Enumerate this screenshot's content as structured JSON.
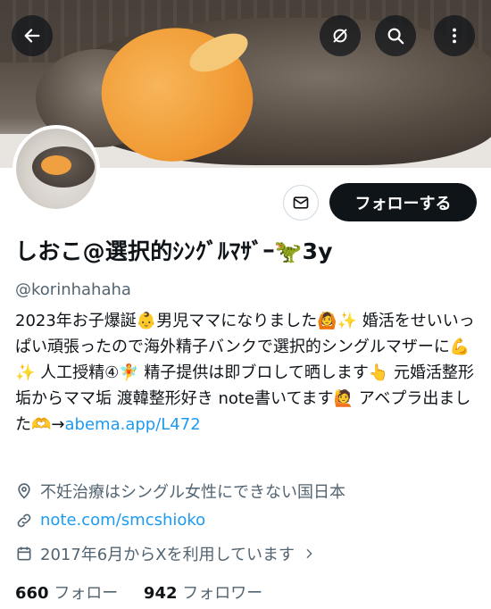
{
  "header": {
    "back_icon": "arrow-left-icon",
    "mute_icon": "mute-icon",
    "search_icon": "search-icon",
    "more_icon": "more-vertical-icon"
  },
  "actions": {
    "message_icon": "mail-icon",
    "follow_label": "フォローする"
  },
  "profile": {
    "display_name": "しおこ@選択的ｼﾝｸﾞﾙﾏｻﾞｰ🦖3y",
    "handle": "@korinhahaha",
    "bio": "2023年お子爆誕👶男児ママになりました🙆✨ 婚活をせいいっぱい頑張ったので海外精子バンクで選択的シングルマザーに💪✨ 人工授精④🧚 精子提供は即ブロして晒します👆 元婚活整形垢からママ垢 渡韓整形好き note書いてます🙋 アベプラ出ました🫶→",
    "bio_link": "abema.app/L472",
    "location": "不妊治療はシングル女性にできない国日本",
    "website": "note.com/smcshioko",
    "joined": "2017年6月からXを利用しています",
    "following_count": "660",
    "following_label": "フォロー",
    "followers_count": "942",
    "followers_label": "フォロワー"
  },
  "colors": {
    "link": "#1d9bf0",
    "secondary_text": "#536471",
    "primary_text": "#0f1419",
    "follow_button_bg": "#0f1419"
  }
}
